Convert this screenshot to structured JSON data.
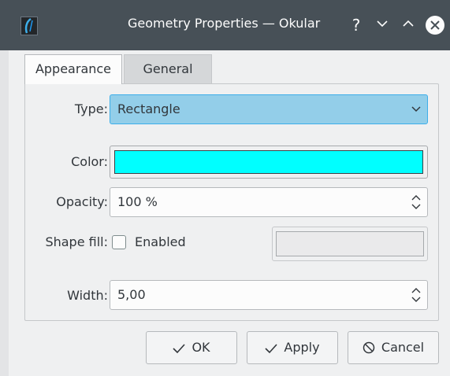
{
  "window": {
    "title": "Geometry Properties — Okular"
  },
  "tabs": [
    {
      "label": "Appearance",
      "active": true
    },
    {
      "label": "General",
      "active": false
    }
  ],
  "form": {
    "type_label": "Type:",
    "type_value": "Rectangle",
    "color_label": "Color:",
    "color_value": "#00ffff",
    "opacity_label": "Opacity:",
    "opacity_value": "100 %",
    "shape_fill_label": "Shape fill:",
    "shape_fill_checkbox_label": "Enabled",
    "shape_fill_checked": false,
    "width_label": "Width:",
    "width_value": "5,00"
  },
  "buttons": {
    "ok": "OK",
    "apply": "Apply",
    "cancel": "Cancel"
  },
  "colors": {
    "titlebar": "#475057",
    "accent": "#3daee9",
    "combo_fill": "#93cee9"
  },
  "icons": {
    "titlebar": [
      "help-icon",
      "minimize-icon",
      "maximize-icon",
      "close-icon"
    ],
    "buttons": [
      "check-icon",
      "check-icon",
      "cancel-icon"
    ]
  }
}
